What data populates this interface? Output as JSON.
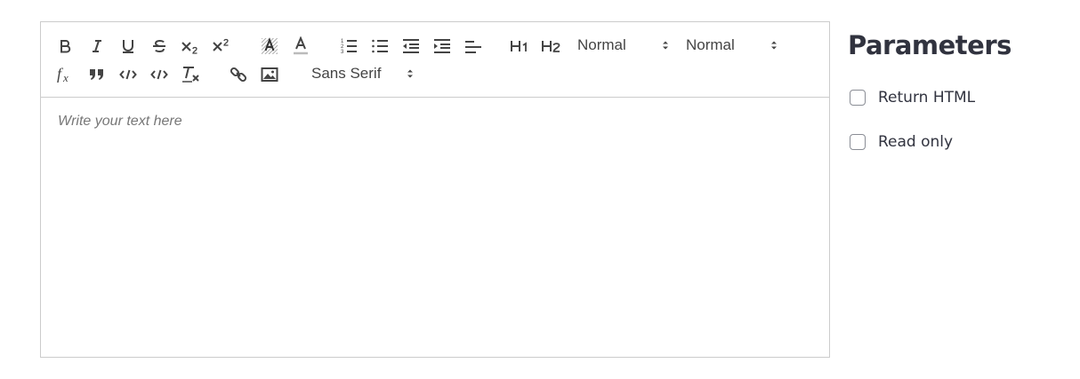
{
  "editor": {
    "toolbar": {
      "row1": [
        {
          "icon": "bold-icon"
        },
        {
          "icon": "italic-icon"
        },
        {
          "icon": "underline-icon"
        },
        {
          "icon": "strikethrough-icon"
        },
        {
          "icon": "subscript-icon"
        },
        {
          "icon": "superscript-icon"
        },
        {
          "icon": "background-color-icon"
        },
        {
          "icon": "text-color-icon"
        },
        {
          "icon": "ordered-list-icon"
        },
        {
          "icon": "bullet-list-icon"
        },
        {
          "icon": "outdent-icon"
        },
        {
          "icon": "indent-icon"
        },
        {
          "icon": "align-left-icon"
        },
        {
          "icon": "heading-1-icon"
        },
        {
          "icon": "heading-2-icon"
        }
      ],
      "header_picker": "Normal",
      "size_picker": "Normal",
      "row2": [
        {
          "icon": "formula-icon"
        },
        {
          "icon": "blockquote-icon"
        },
        {
          "icon": "code-icon"
        },
        {
          "icon": "code-block-icon"
        },
        {
          "icon": "clear-format-icon"
        },
        {
          "icon": "link-icon"
        },
        {
          "icon": "image-icon"
        }
      ],
      "font_picker": "Sans Serif"
    },
    "placeholder": "Write your text here"
  },
  "parameters": {
    "title": "Parameters",
    "options": [
      {
        "label": "Return HTML",
        "checked": false
      },
      {
        "label": "Read only",
        "checked": false
      }
    ]
  },
  "colors": {
    "border": "#cccccc",
    "icon": "#444444",
    "heading": "#31333f"
  }
}
